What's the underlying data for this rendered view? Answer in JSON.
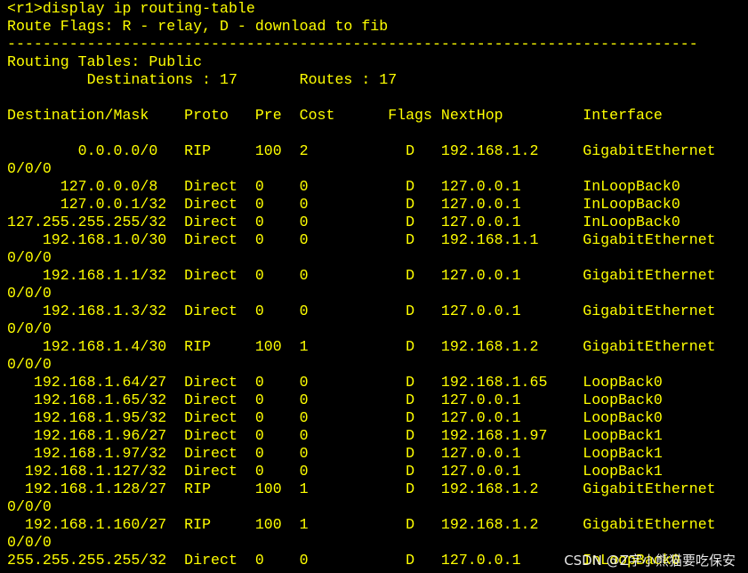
{
  "colors": {
    "background": "#000000",
    "text": "#ffff00"
  },
  "terminal": {
    "command": "<r1>display ip routing-table",
    "flags_legend": "Route Flags: R - relay, D - download to fib",
    "separator": "------------------------------------------------------------------------------",
    "table_name": "Routing Tables: Public",
    "summary": "         Destinations : 17       Routes : 17",
    "header": "Destination/Mask    Proto   Pre  Cost      Flags NextHop         Interface",
    "routes": [
      "        0.0.0.0/0   RIP     100  2           D   192.168.1.2     GigabitEthernet",
      "0/0/0",
      "      127.0.0.0/8   Direct  0    0           D   127.0.0.1       InLoopBack0",
      "      127.0.0.1/32  Direct  0    0           D   127.0.0.1       InLoopBack0",
      "127.255.255.255/32  Direct  0    0           D   127.0.0.1       InLoopBack0",
      "    192.168.1.0/30  Direct  0    0           D   192.168.1.1     GigabitEthernet",
      "0/0/0",
      "    192.168.1.1/32  Direct  0    0           D   127.0.0.1       GigabitEthernet",
      "0/0/0",
      "    192.168.1.3/32  Direct  0    0           D   127.0.0.1       GigabitEthernet",
      "0/0/0",
      "    192.168.1.4/30  RIP     100  1           D   192.168.1.2     GigabitEthernet",
      "0/0/0",
      "   192.168.1.64/27  Direct  0    0           D   192.168.1.65    LoopBack0",
      "   192.168.1.65/32  Direct  0    0           D   127.0.0.1       LoopBack0",
      "   192.168.1.95/32  Direct  0    0           D   127.0.0.1       LoopBack0",
      "   192.168.1.96/27  Direct  0    0           D   192.168.1.97    LoopBack1",
      "   192.168.1.97/32  Direct  0    0           D   127.0.0.1       LoopBack1",
      "  192.168.1.127/32  Direct  0    0           D   127.0.0.1       LoopBack1",
      "  192.168.1.128/27  RIP     100  1           D   192.168.1.2     GigabitEthernet",
      "0/0/0",
      "  192.168.1.160/27  RIP     100  1           D   192.168.1.2     GigabitEthernet",
      "0/0/0",
      "255.255.255.255/32  Direct  0    0           D   127.0.0.1       InLoopBack0"
    ]
  },
  "watermark": "CSDN @Z字小熊猫要吃保安"
}
